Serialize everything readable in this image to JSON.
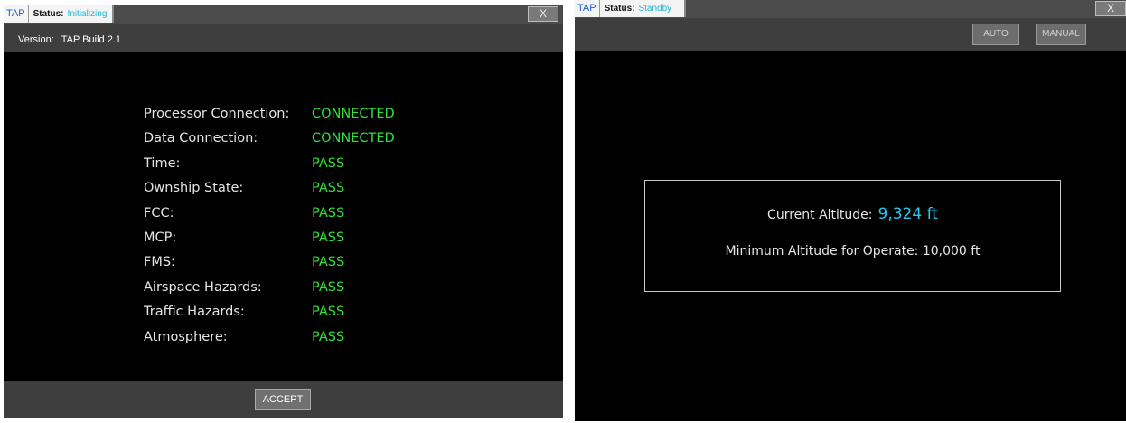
{
  "left_window": {
    "tab_label": "TAP",
    "status_label": "Status:",
    "status_value": "Initializing",
    "close_label": "X",
    "version_label": "Version:",
    "version_value": "TAP Build 2.1",
    "checks": [
      {
        "label": "Processor Connection:",
        "value": "CONNECTED"
      },
      {
        "label": "Data Connection:",
        "value": "CONNECTED"
      },
      {
        "label": "Time:",
        "value": "PASS"
      },
      {
        "label": "Ownship State:",
        "value": "PASS"
      },
      {
        "label": "FCC:",
        "value": "PASS"
      },
      {
        "label": "MCP:",
        "value": "PASS"
      },
      {
        "label": "FMS:",
        "value": "PASS"
      },
      {
        "label": "Airspace Hazards:",
        "value": "PASS"
      },
      {
        "label": "Traffic Hazards:",
        "value": "PASS"
      },
      {
        "label": "Atmosphere:",
        "value": "PASS"
      }
    ],
    "accept_label": "ACCEPT"
  },
  "right_window": {
    "tab_label": "TAP",
    "status_label": "Status:",
    "status_value": "Standby",
    "close_label": "X",
    "auto_label": "AUTO",
    "manual_label": "MANUAL",
    "current_altitude_label": "Current Altitude:",
    "current_altitude_value": "9,324 ft",
    "min_altitude_text": "Minimum Altitude for Operate: 10,000 ft"
  },
  "colors": {
    "pass_green": "#33e03a",
    "status_cyan": "#1fb7d8",
    "altitude_cyan": "#27c9f0",
    "panel_black": "#000000",
    "bar_gray": "#3e3e3e"
  }
}
